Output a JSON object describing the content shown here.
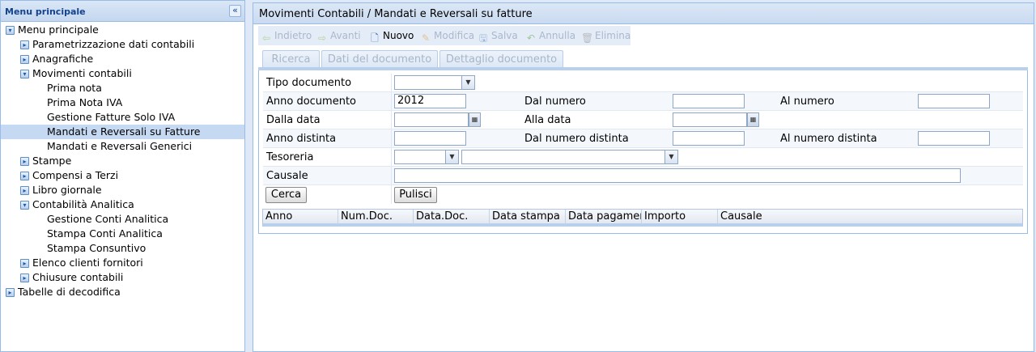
{
  "left_panel": {
    "title": "Menu principale",
    "collapse_glyph": "«",
    "tree": [
      {
        "label": "Menu principale",
        "level": 0,
        "icon": "minus",
        "selected": false
      },
      {
        "label": "Parametrizzazione dati contabili",
        "level": 1,
        "icon": "plus",
        "selected": false
      },
      {
        "label": "Anagrafiche",
        "level": 1,
        "icon": "plus",
        "selected": false
      },
      {
        "label": "Movimenti contabili",
        "level": 1,
        "icon": "minus",
        "selected": false
      },
      {
        "label": "Prima nota",
        "level": 2,
        "icon": "",
        "selected": false
      },
      {
        "label": "Prima Nota IVA",
        "level": 2,
        "icon": "",
        "selected": false
      },
      {
        "label": "Gestione Fatture Solo IVA",
        "level": 2,
        "icon": "",
        "selected": false
      },
      {
        "label": "Mandati e Reversali su Fatture",
        "level": 2,
        "icon": "",
        "selected": true
      },
      {
        "label": "Mandati e Reversali Generici",
        "level": 2,
        "icon": "",
        "selected": false
      },
      {
        "label": "Stampe",
        "level": 1,
        "icon": "plus",
        "selected": false
      },
      {
        "label": "Compensi a Terzi",
        "level": 1,
        "icon": "plus",
        "selected": false
      },
      {
        "label": "Libro giornale",
        "level": 1,
        "icon": "plus",
        "selected": false
      },
      {
        "label": "Contabilità Analitica",
        "level": 1,
        "icon": "minus",
        "selected": false
      },
      {
        "label": "Gestione Conti Analitica",
        "level": 2,
        "icon": "",
        "selected": false
      },
      {
        "label": "Stampa Conti Analitica",
        "level": 2,
        "icon": "",
        "selected": false
      },
      {
        "label": "Stampa Consuntivo",
        "level": 2,
        "icon": "",
        "selected": false
      },
      {
        "label": "Elenco clienti fornitori",
        "level": 1,
        "icon": "plus",
        "selected": false
      },
      {
        "label": "Chiusure contabili",
        "level": 1,
        "icon": "plus",
        "selected": false
      },
      {
        "label": "Tabelle di decodifica",
        "level": 0,
        "icon": "plus",
        "selected": false
      }
    ]
  },
  "right_panel": {
    "title": "Movimenti Contabili / Mandati e Reversali su fatture",
    "toolbar": [
      {
        "label": "Indietro",
        "icon": "arrow-left-icon",
        "glyph": "⇦",
        "enabled": false,
        "color": "#8bc34a"
      },
      {
        "label": "Avanti",
        "icon": "arrow-right-icon",
        "glyph": "⇨",
        "enabled": false,
        "color": "#8bc34a"
      },
      {
        "label": "Nuovo",
        "icon": "new-document-icon",
        "glyph": "🗋",
        "enabled": true,
        "color": "#3b6fb6"
      },
      {
        "label": "Modifica",
        "icon": "edit-icon",
        "glyph": "✎",
        "enabled": false,
        "color": "#d9a441"
      },
      {
        "label": "Salva",
        "icon": "save-icon",
        "glyph": "🖫",
        "enabled": false,
        "color": "#5f8dc4"
      },
      {
        "label": "Annulla",
        "icon": "undo-icon",
        "glyph": "↶",
        "enabled": false,
        "color": "#6aa84f"
      },
      {
        "label": "Elimina",
        "icon": "delete-icon",
        "glyph": "🗑",
        "enabled": false,
        "color": "#999999"
      }
    ],
    "tabs": [
      {
        "label": "Ricerca",
        "active": true
      },
      {
        "label": "Dati del documento",
        "active": false
      },
      {
        "label": "Dettaglio documento",
        "active": false
      }
    ],
    "form": {
      "tipo_documento_label": "Tipo documento",
      "tipo_documento_value": "",
      "anno_documento_label": "Anno documento",
      "anno_documento_value": "2012",
      "dal_numero_label": "Dal numero",
      "dal_numero_value": "",
      "al_numero_label": "Al numero",
      "al_numero_value": "",
      "dalla_data_label": "Dalla data",
      "dalla_data_value": "",
      "alla_data_label": "Alla data",
      "alla_data_value": "",
      "anno_distinta_label": "Anno distinta",
      "anno_distinta_value": "",
      "dal_numero_distinta_label": "Dal numero distinta",
      "dal_numero_distinta_value": "",
      "al_numero_distinta_label": "Al numero distinta",
      "al_numero_distinta_value": "",
      "tesoreria_label": "Tesoreria",
      "tesoreria_value_1": "",
      "tesoreria_value_2": "",
      "causale_label": "Causale",
      "causale_value": "",
      "cerca_label": "Cerca",
      "pulisci_label": "Pulisci"
    },
    "grid_columns": [
      "Anno",
      "Num.Doc.",
      "Data.Doc.",
      "Data stampa",
      "Data pagamen",
      "Importo",
      "Causale"
    ]
  }
}
